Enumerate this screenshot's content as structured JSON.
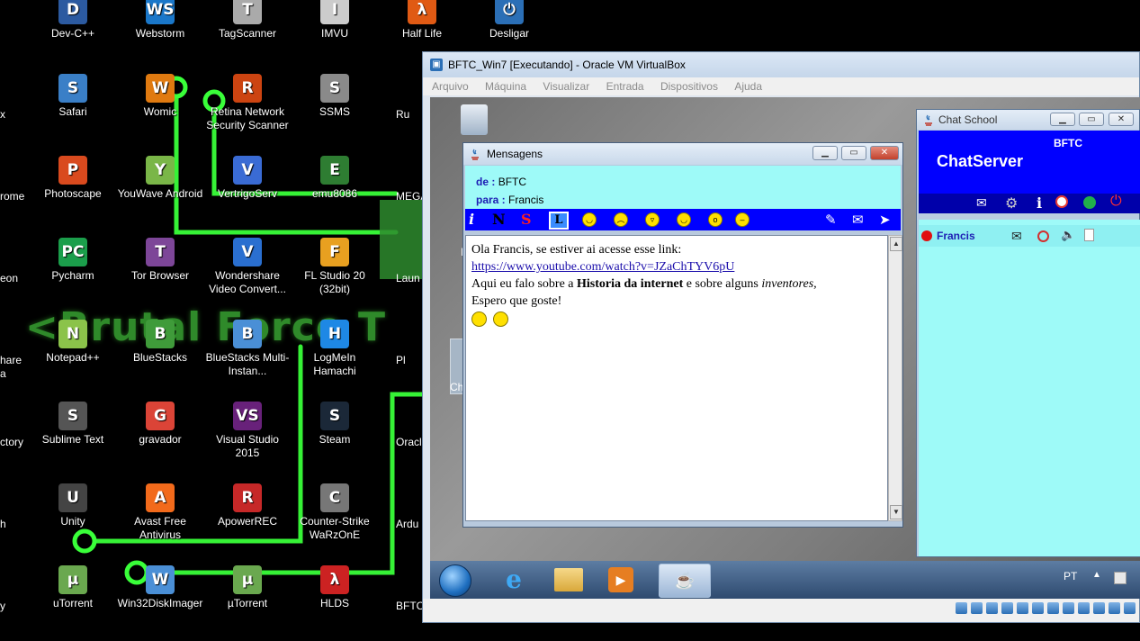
{
  "desktop": {
    "icons": [
      {
        "label": "Dev-C++",
        "glyph": "D",
        "color": "#2c5aa0"
      },
      {
        "label": "Webstorm",
        "glyph": "WS",
        "color": "#1a77c9"
      },
      {
        "label": "TagScanner",
        "glyph": "T",
        "color": "#aaaaaa"
      },
      {
        "label": "IMVU",
        "glyph": "I",
        "color": "#cccccc"
      },
      {
        "label": "Half Life",
        "glyph": "λ",
        "color": "#e05a14"
      },
      {
        "label": "Desligar",
        "glyph": "⏻",
        "color": "#2b6fb6"
      },
      {
        "label": "Safari",
        "glyph": "S",
        "color": "#3a7fc7"
      },
      {
        "label": "Womic",
        "glyph": "W",
        "color": "#e07a10"
      },
      {
        "label": "Retina Network Security Scanner",
        "glyph": "R",
        "color": "#cc4411"
      },
      {
        "label": "SSMS",
        "glyph": "S",
        "color": "#8a8a8a"
      },
      {
        "label": "Photoscape",
        "glyph": "P",
        "color": "#d94a1e"
      },
      {
        "label": "YouWave Android",
        "glyph": "Y",
        "color": "#7ab648"
      },
      {
        "label": "VertrigoServ",
        "glyph": "V",
        "color": "#3a6bd4"
      },
      {
        "label": "emu8086",
        "glyph": "E",
        "color": "#2e7d32"
      },
      {
        "label": "Pycharm",
        "glyph": "PC",
        "color": "#1b9e4b"
      },
      {
        "label": "Tor Browser",
        "glyph": "T",
        "color": "#7d4698"
      },
      {
        "label": "Wondershare Video Convert...",
        "glyph": "V",
        "color": "#2a6fd0"
      },
      {
        "label": "FL Studio 20 (32bit)",
        "glyph": "F",
        "color": "#e8a020"
      },
      {
        "label": "Notepad++",
        "glyph": "N",
        "color": "#8bc34a"
      },
      {
        "label": "BlueStacks",
        "glyph": "B",
        "color": "#3f9b3a"
      },
      {
        "label": "BlueStacks Multi-Instan...",
        "glyph": "B",
        "color": "#4a8fd6"
      },
      {
        "label": "LogMeIn Hamachi",
        "glyph": "H",
        "color": "#1e88e5"
      },
      {
        "label": "Sublime Text",
        "glyph": "S",
        "color": "#555555"
      },
      {
        "label": "gravador",
        "glyph": "G",
        "color": "#db4437"
      },
      {
        "label": "Visual Studio 2015",
        "glyph": "VS",
        "color": "#68217a"
      },
      {
        "label": "Steam",
        "glyph": "S",
        "color": "#1b2838"
      },
      {
        "label": "Unity",
        "glyph": "U",
        "color": "#444444"
      },
      {
        "label": "Avast Free Antivirus",
        "glyph": "A",
        "color": "#f26a1b"
      },
      {
        "label": "ApowerREC",
        "glyph": "R",
        "color": "#c62828"
      },
      {
        "label": "Counter-Strike WaRzOnE",
        "glyph": "C",
        "color": "#777777"
      },
      {
        "label": "uTorrent",
        "glyph": "µ",
        "color": "#6aa84f"
      },
      {
        "label": "Win32DiskImager",
        "glyph": "W",
        "color": "#4a8fd6"
      },
      {
        "label": "µTorrent",
        "glyph": "µ",
        "color": "#6aa84f"
      },
      {
        "label": "HLDS",
        "glyph": "λ",
        "color": "#cc2222"
      }
    ],
    "edge_labels": [
      "x",
      "rome",
      "eon",
      "hare",
      "a",
      "ctory",
      "h",
      "y"
    ],
    "partial_labels": [
      "Ru",
      "MEGA",
      "Laun",
      "Pl",
      "Oracl Virtu",
      "Ardu",
      "BFTC_"
    ],
    "banner": "<Brutal Force T"
  },
  "vbox": {
    "title": "BFTC_Win7 [Executando] - Oracle VM VirtualBox",
    "menu": [
      "Arquivo",
      "Máquina",
      "Visualizar",
      "Entrada",
      "Dispositivos",
      "Ajuda"
    ],
    "guest_icon_labels": [
      "L",
      "Ch"
    ],
    "taskbar_lang": "PT"
  },
  "mensagens": {
    "title": "Mensagens",
    "de_label": "de :",
    "de_value": "BFTC",
    "para_label": "para :",
    "para_value": "Francis",
    "toolbar": {
      "italic": "i",
      "bold": "N",
      "strike": "S",
      "link": "L"
    },
    "body": {
      "line1": "Ola Francis, se estiver ai acesse esse link:",
      "link": "https://www.youtube.com/watch?v=JZaChTYV6pU",
      "line3_pre": "Aqui eu falo sobre a ",
      "line3_bold": "Historia da internet",
      "line3_mid": " e sobre alguns ",
      "line3_italic": "inventores,",
      "line4": "Espero que goste!"
    }
  },
  "chat": {
    "title": "Chat School",
    "user": "BFTC",
    "server": "ChatServer",
    "contacts": [
      {
        "name": "Francis",
        "status_color": "#e01010"
      }
    ]
  }
}
